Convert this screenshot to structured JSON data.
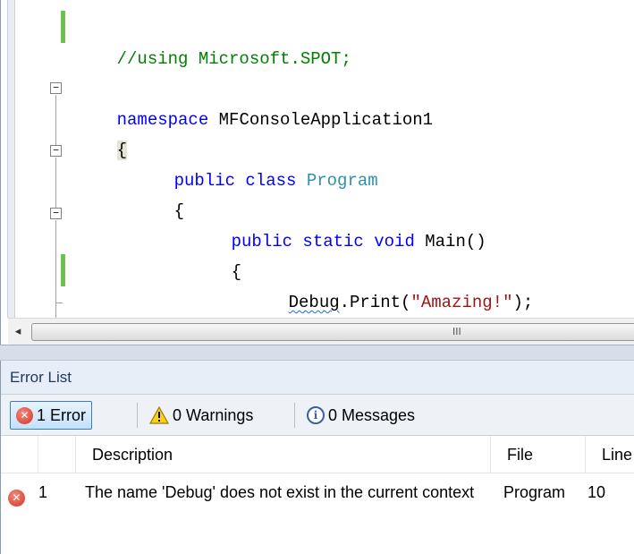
{
  "editor": {
    "lines": {
      "using_comment": "//using Microsoft.SPOT;",
      "ns_kw": "namespace",
      "ns_name": " MFConsoleApplication1",
      "brace_open_1": "{",
      "class_kw": "public class",
      "class_name": "Program",
      "brace_open_2": "{",
      "method_kw": "public static void",
      "method_name": " Main()",
      "brace_open_3": "{",
      "debug_ident": "Debug",
      "debug_call": ".Print(",
      "debug_string": "\"Amazing!\"",
      "debug_end": ");",
      "brace_close_3": "}"
    },
    "fold_glyph": "−",
    "scroll_left_glyph": "◂",
    "scroll_grip_glyph": "III"
  },
  "error_list": {
    "title": "Error List",
    "toolbar": {
      "errors_label": "1 Error",
      "warnings_label": "0 Warnings",
      "messages_label": "0 Messages"
    },
    "columns": {
      "description": "Description",
      "file": "File",
      "line": "Line"
    },
    "rows": [
      {
        "index": "1",
        "description": "The name 'Debug' does not exist in the current context",
        "file": "Program",
        "line": "10"
      }
    ]
  },
  "icons": {
    "error": "error-icon",
    "warning": "warning-icon",
    "info": "info-icon"
  },
  "colors": {
    "keyword": "#0000ff",
    "type": "#2b91af",
    "comment": "#008000",
    "string": "#a31515",
    "change_marker": "#6cc24a",
    "error_red": "#d2311f"
  }
}
